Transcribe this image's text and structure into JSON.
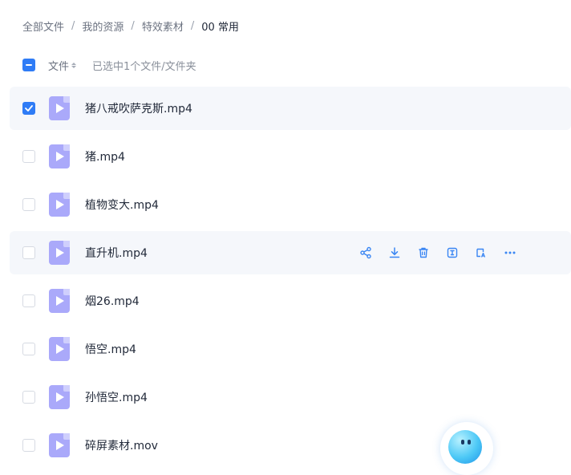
{
  "breadcrumb": {
    "items": [
      "全部文件",
      "我的资源",
      "特效素材",
      "00 常用"
    ],
    "separator": "/"
  },
  "list_header": {
    "column_label": "文件",
    "selection_text": "已选中1个文件/文件夹"
  },
  "files": [
    {
      "name": "猪八戒吹萨克斯.mp4",
      "checked": true
    },
    {
      "name": "猪.mp4",
      "checked": false
    },
    {
      "name": "植物变大.mp4",
      "checked": false
    },
    {
      "name": "直升机.mp4",
      "checked": false
    },
    {
      "name": "烟26.mp4",
      "checked": false
    },
    {
      "name": "悟空.mp4",
      "checked": false
    },
    {
      "name": "孙悟空.mp4",
      "checked": false
    },
    {
      "name": "碎屏素材.mov",
      "checked": false
    }
  ],
  "row_actions_icons": [
    "share-icon",
    "download-icon",
    "delete-icon",
    "rename-icon",
    "ai-icon",
    "more-icon"
  ],
  "colors": {
    "accent": "#2f7cf6",
    "action_icon": "#3a86f3",
    "video_icon": "#aaa9fa",
    "selected_row_bg": "#f5f7fb"
  }
}
